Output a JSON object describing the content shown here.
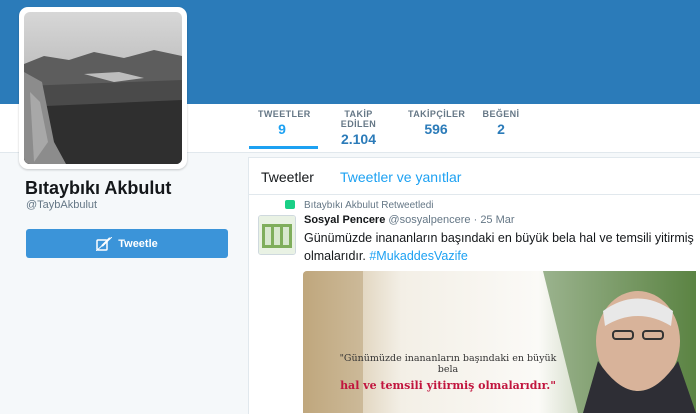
{
  "profile": {
    "name": "Bıtaybıkı Akbulut",
    "handle": "@TaybAkbulut",
    "tweet_button_label": "Tweetle"
  },
  "stats": [
    {
      "label": "TWEETLER",
      "value": "9"
    },
    {
      "label": "TAKİP EDİLEN",
      "value": "2.104"
    },
    {
      "label": "TAKİPÇİLER",
      "value": "596"
    },
    {
      "label": "BEĞENİ",
      "value": "2"
    }
  ],
  "timeline": {
    "tabs": [
      "Tweetler",
      "Tweetler ve yanıtlar"
    ],
    "retweet_notice": "Bıtaybıkı Akbulut Retweetledi",
    "tweet": {
      "author": "Sosyal Pencere",
      "handle": "@sosyalpencere",
      "separator": "·",
      "date": "25 Mar",
      "text": "Günümüzde inananların başındaki en büyük bela hal ve temsili yitirmiş olmalarıdır.",
      "hashtag": "#MukaddesVazife",
      "media_quote_line1": "\"Günümüzde inananların başındaki en büyük bela",
      "media_quote_line2": "hal ve temsili yitirmiş olmalarıdır.\""
    }
  },
  "colors": {
    "header": "#2b7bb9",
    "accent": "#1da1f2",
    "button": "#3b94d9",
    "retweet_green": "#19cf86",
    "quote_red": "#c1153e"
  },
  "icons": [
    "retweet-icon",
    "compose-tweet-icon"
  ]
}
